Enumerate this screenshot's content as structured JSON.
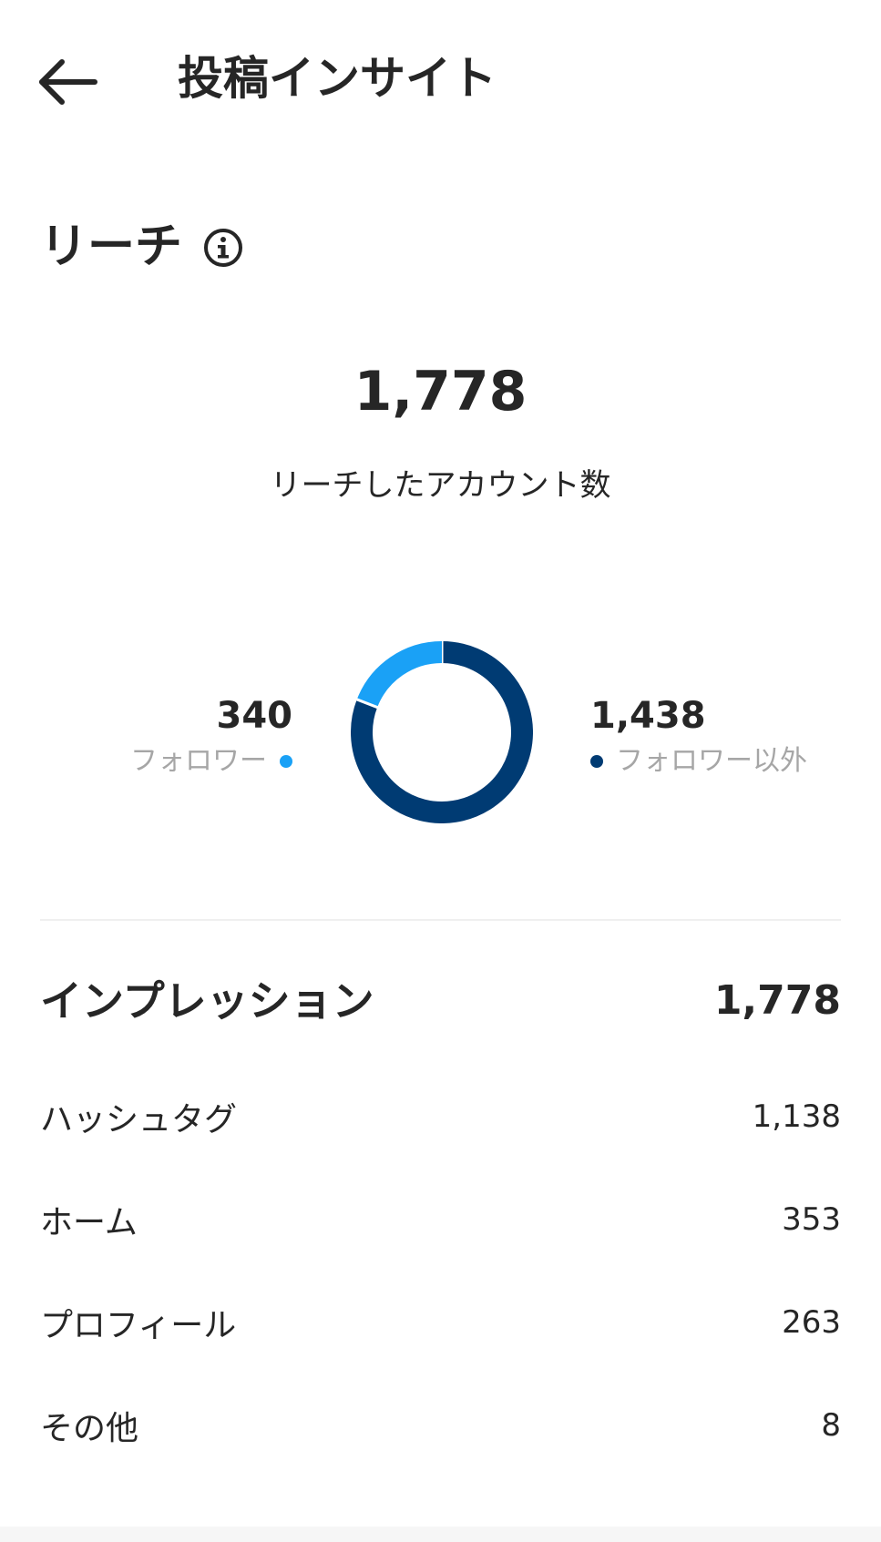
{
  "header": {
    "title": "投稿インサイト",
    "back_icon": "arrow-left-icon"
  },
  "reach": {
    "title": "リーチ",
    "info_icon": "info-circle-icon",
    "value": "1,778",
    "subtitle": "リーチしたアカウント数",
    "followers": {
      "value": "340",
      "label": "フォロワー",
      "color": "#1aa1f6"
    },
    "non_followers": {
      "value": "1,438",
      "label": "フォロワー以外",
      "color": "#003b73"
    }
  },
  "chart_data": {
    "type": "pie",
    "donut": true,
    "categories": [
      "フォロワー",
      "フォロワー以外"
    ],
    "values": [
      340,
      1438
    ],
    "colors": [
      "#1aa1f6",
      "#003b73"
    ]
  },
  "impressions": {
    "title": "インプレッション",
    "total": "1,778",
    "rows": [
      {
        "label": "ハッシュタグ",
        "value": "1,138"
      },
      {
        "label": "ホーム",
        "value": "353"
      },
      {
        "label": "プロフィール",
        "value": "263"
      },
      {
        "label": "その他",
        "value": "8"
      }
    ]
  }
}
